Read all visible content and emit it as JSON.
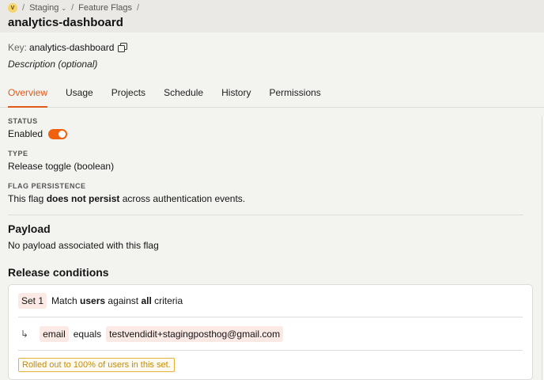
{
  "breadcrumb": {
    "avatar_initial": "V",
    "env": "Staging",
    "section": "Feature Flags",
    "sep": "/"
  },
  "header": {
    "title": "analytics-dashboard"
  },
  "flag": {
    "key_label": "Key:",
    "key_value": "analytics-dashboard",
    "description": "Description (optional)"
  },
  "tabs": [
    {
      "label": "Overview",
      "active": true
    },
    {
      "label": "Usage"
    },
    {
      "label": "Projects"
    },
    {
      "label": "Schedule"
    },
    {
      "label": "History"
    },
    {
      "label": "Permissions"
    }
  ],
  "status": {
    "label": "STATUS",
    "value": "Enabled",
    "enabled": true
  },
  "type": {
    "label": "TYPE",
    "value": "Release toggle (boolean)"
  },
  "persistence": {
    "label": "FLAG PERSISTENCE",
    "prefix": "This flag ",
    "bold": "does not persist",
    "suffix": " across authentication events."
  },
  "payload": {
    "title": "Payload",
    "text": "No payload associated with this flag"
  },
  "conditions": {
    "title": "Release conditions",
    "set_label": "Set 1",
    "match_prefix": "Match ",
    "match_users": "users",
    "match_mid": " against ",
    "match_all": "all",
    "match_suffix": " criteria",
    "property": "email",
    "operator": "equals",
    "value": "testvendidit+stagingposthog@gmail.com",
    "rollout": "Rolled out to 100% of users in this set."
  },
  "colors": {
    "accent": "#e05a1c",
    "toggle": "#f1600d",
    "warning": "#c48c08"
  }
}
